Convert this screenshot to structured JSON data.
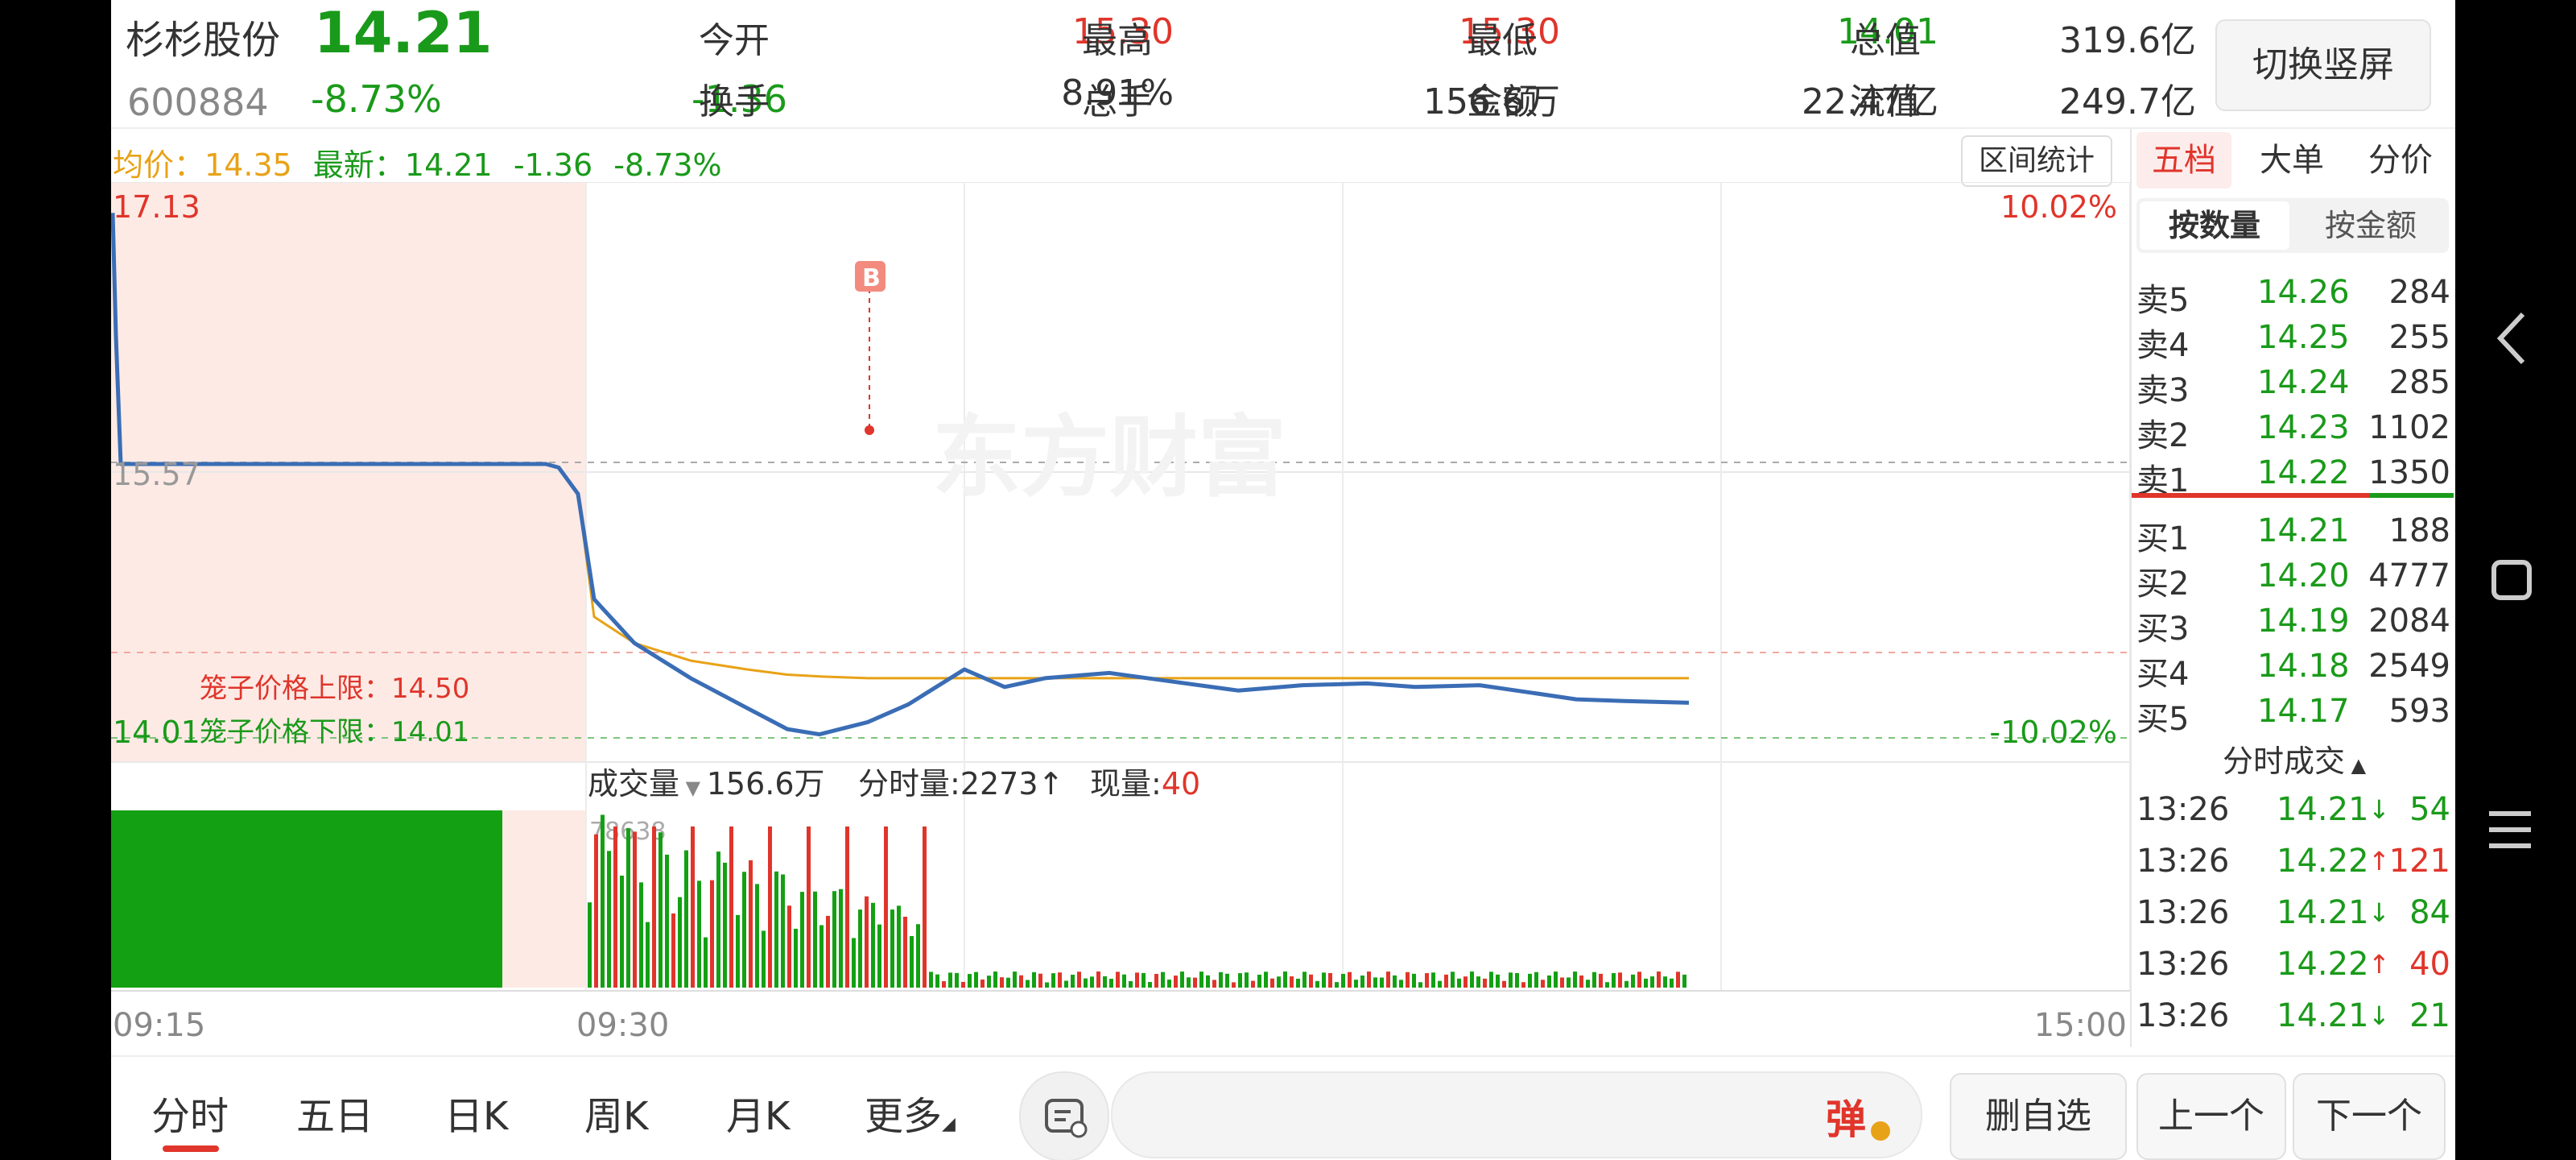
{
  "header": {
    "name": "杉杉股份",
    "code": "600884",
    "price": "14.21",
    "change_pct": "-8.73%",
    "change": "-1.36",
    "open_label": "今开",
    "open": "15.30",
    "high_label": "最高",
    "high": "15.30",
    "low_label": "最低",
    "low": "14.01",
    "cap_label": "总值",
    "cap": "319.6亿",
    "turnover_label": "换手",
    "turnover": "8.91%",
    "vol_label": "总手",
    "vol": "156.6万",
    "amount_label": "金额",
    "amount": "22.47亿",
    "float_label": "流值",
    "float": "249.7亿",
    "switch_button": "切换竖屏"
  },
  "info_bar": {
    "avg_label": "均价：",
    "avg": "14.35",
    "latest_label": "最新：",
    "latest": "14.21",
    "change": "-1.36",
    "change_pct": "-8.73%",
    "interval_button": "区间统计"
  },
  "chart": {
    "price_top": "17.13",
    "pct_top": "10.02%",
    "prev_close": "15.57",
    "price_low": "14.01",
    "pct_bottom": "-10.02%",
    "cage_upper_label": "笼子价格上限：14.50",
    "cage_lower_label": "笼子价格下限：14.01",
    "watermark": "东方财富",
    "buy_marker": "B",
    "volume_label": "成交量",
    "volume_total": "156.6万",
    "minute_vol_label": "分时量:2273",
    "arrow_up": "↑",
    "current_vol_label": "现量:",
    "current_vol": "40",
    "volume_max": "78638",
    "time_start": "09:15",
    "time_open": "09:30",
    "time_end": "15:00"
  },
  "chart_data": {
    "type": "line",
    "xlabel": "",
    "ylabel": "",
    "ylim": [
      14.01,
      17.13
    ],
    "x_ticks": [
      "09:15",
      "09:30",
      "15:00"
    ],
    "series": [
      {
        "name": "",
        "values": [
          17.0,
          16.3,
          15.57,
          15.57,
          15.57,
          15.57,
          15.55,
          15.4,
          14.8,
          14.55,
          14.35,
          14.18,
          14.06,
          14.03,
          14.1,
          14.2,
          14.4,
          14.3,
          14.35,
          14.38,
          14.33,
          14.28,
          14.31,
          14.32,
          14.3,
          14.31,
          14.27,
          14.23,
          14.22,
          14.21
        ]
      },
      {
        "name": "",
        "values": [
          15.57,
          15.57,
          15.57,
          15.57,
          15.57,
          15.57,
          15.55,
          15.4,
          14.7,
          14.55,
          14.45,
          14.4,
          14.37,
          14.36,
          14.35,
          14.35,
          14.35,
          14.35,
          14.35,
          14.35,
          14.35,
          14.35,
          14.35,
          14.35,
          14.35,
          14.35,
          14.35,
          14.35,
          14.35,
          14.35
        ]
      }
    ]
  },
  "right_panel": {
    "tabs": [
      "五档",
      "大单",
      "分价"
    ],
    "subtabs": [
      "按数量",
      "按金额"
    ],
    "sells": [
      {
        "label": "卖5",
        "price": "14.26",
        "vol": "284"
      },
      {
        "label": "卖4",
        "price": "14.25",
        "vol": "255"
      },
      {
        "label": "卖3",
        "price": "14.24",
        "vol": "285"
      },
      {
        "label": "卖2",
        "price": "14.23",
        "vol": "1102"
      },
      {
        "label": "卖1",
        "price": "14.22",
        "vol": "1350"
      }
    ],
    "buys": [
      {
        "label": "买1",
        "price": "14.21",
        "vol": "188"
      },
      {
        "label": "买2",
        "price": "14.20",
        "vol": "4777"
      },
      {
        "label": "买3",
        "price": "14.19",
        "vol": "2084"
      },
      {
        "label": "买4",
        "price": "14.18",
        "vol": "2549"
      },
      {
        "label": "买5",
        "price": "14.17",
        "vol": "593"
      }
    ],
    "ticks_title": "分时成交",
    "ticks": [
      {
        "time": "13:26",
        "price": "14.21",
        "dir": "↓",
        "vol": "54"
      },
      {
        "time": "13:26",
        "price": "14.22",
        "dir": "↑",
        "vol": "121"
      },
      {
        "time": "13:26",
        "price": "14.21",
        "dir": "↓",
        "vol": "84"
      },
      {
        "time": "13:26",
        "price": "14.22",
        "dir": "↑",
        "vol": "40"
      },
      {
        "time": "13:26",
        "price": "14.21",
        "dir": "↓",
        "vol": "21"
      }
    ]
  },
  "bottom": {
    "tabs": [
      "分时",
      "五日",
      "日K",
      "周K",
      "月K",
      "更多"
    ],
    "danmu_icon": "弹",
    "remove_button": "删自选",
    "prev_button": "上一个",
    "next_button": "下一个"
  },
  "colors": {
    "up": "#e0352b",
    "down": "#1a9a1a",
    "avg": "#e8a218",
    "line": "#3a6db5"
  },
  "system_icons": [
    "back-chevron-icon",
    "recent-apps-icon",
    "menu-icon"
  ]
}
